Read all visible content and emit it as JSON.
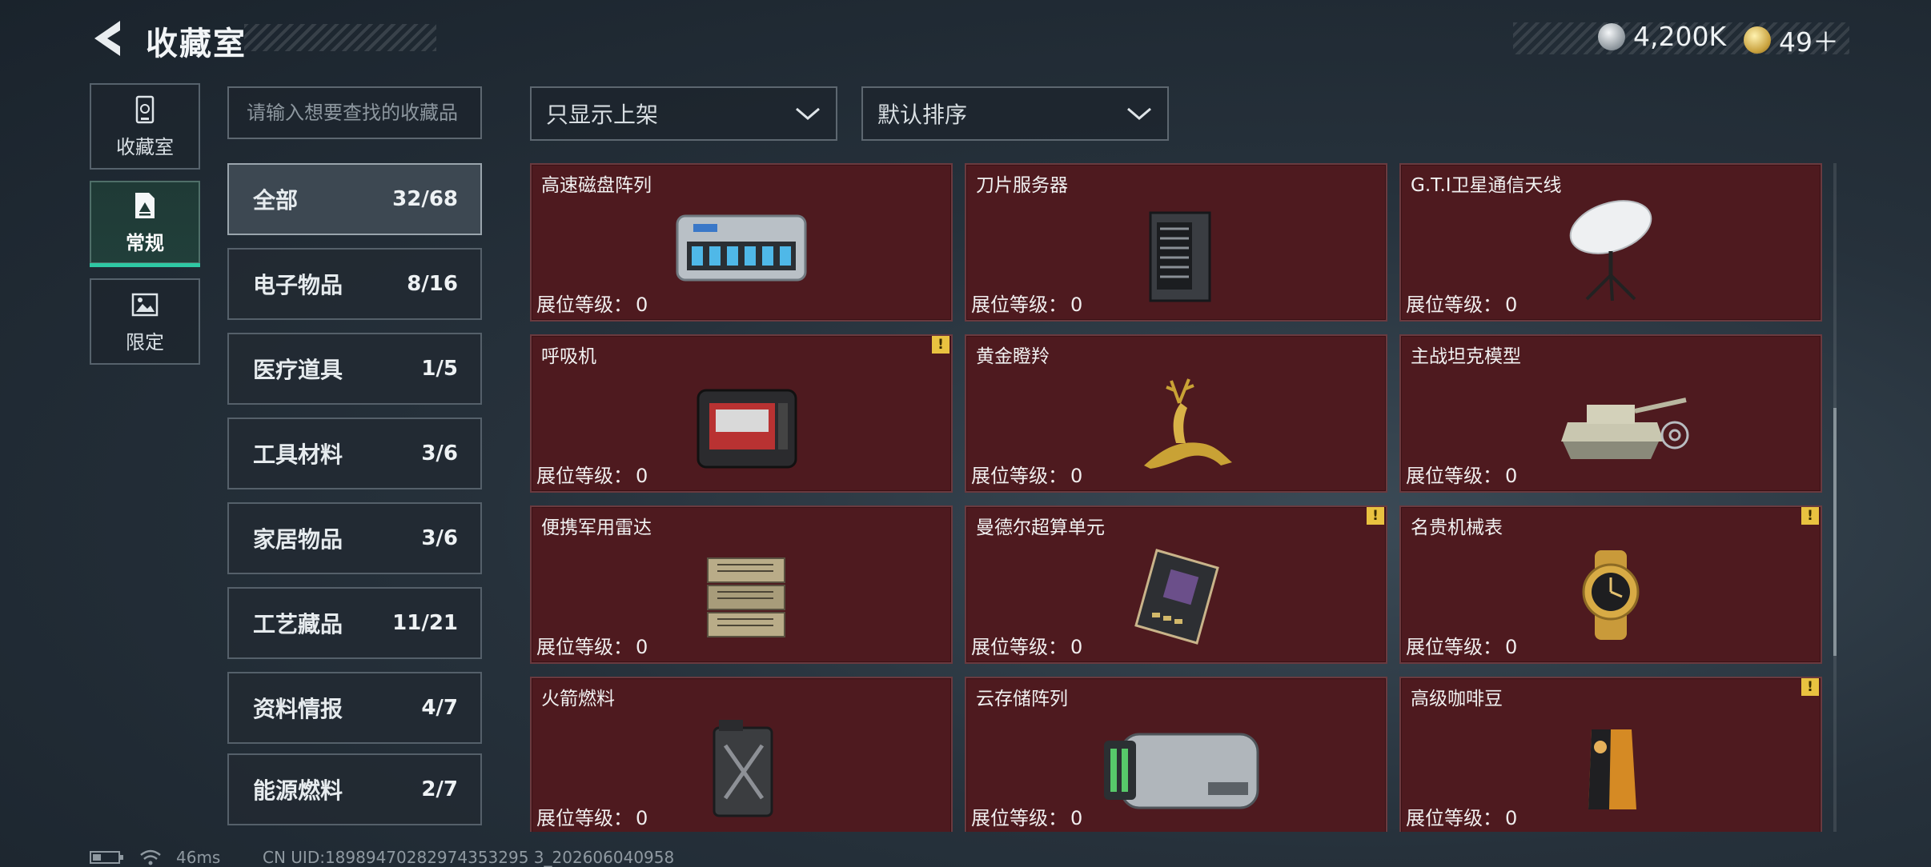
{
  "header": {
    "title": "收藏室",
    "currency_primary": "4,200K",
    "currency_secondary": "49＋"
  },
  "rail": [
    {
      "label": "收藏室",
      "icon": "collection-box-icon"
    },
    {
      "label": "常规",
      "icon": "document-icon",
      "active": true
    },
    {
      "label": "限定",
      "icon": "limited-image-icon"
    }
  ],
  "search": {
    "placeholder": "请输入想要查找的收藏品"
  },
  "filters": {
    "display": "只显示上架",
    "sort": "默认排序"
  },
  "categories": [
    {
      "name": "全部",
      "count": "32/68",
      "active": true
    },
    {
      "name": "电子物品",
      "count": "8/16"
    },
    {
      "name": "医疗道具",
      "count": "1/5"
    },
    {
      "name": "工具材料",
      "count": "3/6"
    },
    {
      "name": "家居物品",
      "count": "3/6"
    },
    {
      "name": "工艺藏品",
      "count": "11/21"
    },
    {
      "name": "资料情报",
      "count": "4/7"
    },
    {
      "name": "能源燃料",
      "count": "2/7"
    }
  ],
  "level_label": "展位等级：",
  "items": [
    {
      "name": "高速磁盘阵列",
      "level": "0",
      "warn": false,
      "icon": "disk-array-icon"
    },
    {
      "name": "刀片服务器",
      "level": "0",
      "warn": false,
      "icon": "blade-server-icon"
    },
    {
      "name": "G.T.I卫星通信天线",
      "level": "0",
      "warn": false,
      "icon": "satellite-antenna-icon"
    },
    {
      "name": "呼吸机",
      "level": "0",
      "warn": true,
      "icon": "ventilator-icon"
    },
    {
      "name": "黄金瞪羚",
      "level": "0",
      "warn": false,
      "icon": "golden-gazelle-icon"
    },
    {
      "name": "主战坦克模型",
      "level": "0",
      "warn": false,
      "icon": "tank-model-icon"
    },
    {
      "name": "便携军用雷达",
      "level": "0",
      "warn": false,
      "icon": "military-radar-icon"
    },
    {
      "name": "曼德尔超算单元",
      "level": "0",
      "warn": true,
      "icon": "supercomputer-unit-icon"
    },
    {
      "name": "名贵机械表",
      "level": "0",
      "warn": true,
      "icon": "mechanical-watch-icon"
    },
    {
      "name": "火箭燃料",
      "level": "0",
      "warn": false,
      "icon": "rocket-fuel-can-icon"
    },
    {
      "name": "云存储阵列",
      "level": "0",
      "warn": false,
      "icon": "cloud-storage-array-icon"
    },
    {
      "name": "高级咖啡豆",
      "level": "0",
      "warn": true,
      "icon": "coffee-bean-bag-icon"
    }
  ],
  "warn_glyph": "!",
  "status": {
    "ping": "46ms",
    "uid": "CN UID:18989470282974353295 3_202606040958"
  }
}
